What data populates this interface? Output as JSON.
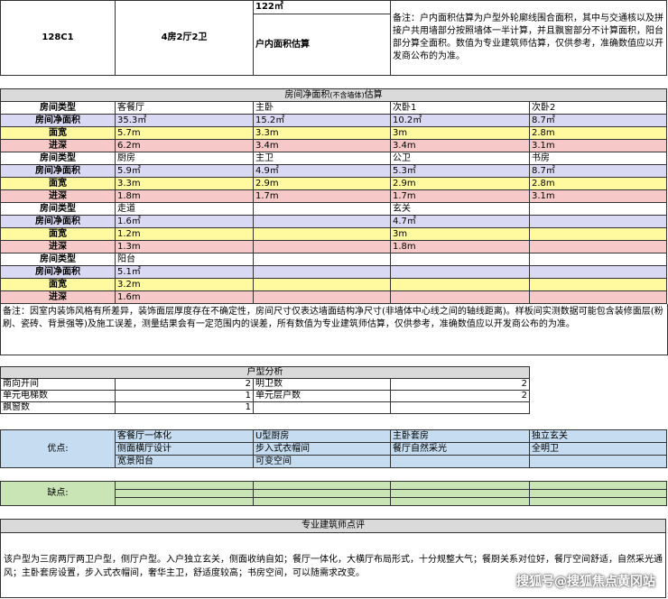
{
  "header": {
    "plan_code": "128C1",
    "layout": "4房2厅2卫",
    "area": "122㎡",
    "area_label": "户内面积估算",
    "note": "备注：户内面积估算为户型外轮廓线围合面积，其中与交通核以及拼接户共用墙部分按照墙体一半计算，并且飘窗部分不计算面积，阳台部分算全面积。数值为专业建筑师估算，仅供参考，准确数值应以开发商公布的为准。"
  },
  "rooms": {
    "title_main": "房间净面积",
    "title_small": "(不含墙体)",
    "title_tail": "估算",
    "labels": {
      "type": "房间类型",
      "area": "房间净面积",
      "width": "面宽",
      "depth": "进深"
    },
    "groups": [
      [
        {
          "name": "客餐厅",
          "area": "35.3㎡",
          "width": "5.7m",
          "depth": "6.2m"
        },
        {
          "name": "主卧",
          "area": "15.2㎡",
          "width": "3.3m",
          "depth": "3.4m"
        },
        {
          "name": "次卧1",
          "area": "10.2㎡",
          "width": "3m",
          "depth": "3.4m"
        },
        {
          "name": "次卧2",
          "area": "8.7㎡",
          "width": "2.8m",
          "depth": "3.1m"
        }
      ],
      [
        {
          "name": "厨房",
          "area": "5.9㎡",
          "width": "3.3m",
          "depth": "1.8m"
        },
        {
          "name": "主卫",
          "area": "4.9㎡",
          "width": "2.9m",
          "depth": "1.7m"
        },
        {
          "name": "公卫",
          "area": "5.3㎡",
          "width": "2.9m",
          "depth": "1.7m"
        },
        {
          "name": "书房",
          "area": "8.7㎡",
          "width": "2.8m",
          "depth": "3.1m"
        }
      ],
      [
        {
          "name": "走道",
          "area": "1.6㎡",
          "width": "1.2m",
          "depth": "1.3m"
        },
        {
          "name": "",
          "area": "",
          "width": "",
          "depth": ""
        },
        {
          "name": "玄关",
          "area": "4.7㎡",
          "width": "3m",
          "depth": "1.8m"
        },
        {
          "name": "",
          "area": "",
          "width": "",
          "depth": ""
        }
      ],
      [
        {
          "name": "阳台",
          "area": "5.1㎡",
          "width": "3.2m",
          "depth": "1.6m"
        },
        {
          "name": "",
          "area": "",
          "width": "",
          "depth": ""
        },
        {
          "name": "",
          "area": "",
          "width": "",
          "depth": ""
        },
        {
          "name": "",
          "area": "",
          "width": "",
          "depth": ""
        }
      ]
    ],
    "note": "备注：因室内装饰风格有所差异，装饰面层厚度存在不确定性，房间尺寸仅表达墙面结构净尺寸(非墙体中心线之间的轴线距离)。样板间实测数据可能包含装修面层(粉刷、瓷砖、背景强等)及施工误差，测量结果会有一定范围内的误差，所有数值为专业建筑师估算，仅供参考，准确数值应以开发商公布的为准。"
  },
  "analysis": {
    "title": "户型分析",
    "rows": [
      {
        "l_label": "南向开间",
        "l_val": "2",
        "r_label": "明卫数",
        "r_val": "2"
      },
      {
        "l_label": "单元电梯数",
        "l_val": "1",
        "r_label": "单元层户数",
        "r_val": "2"
      },
      {
        "l_label": "飘窗数",
        "l_val": "1",
        "r_label": "",
        "r_val": ""
      }
    ]
  },
  "pros": {
    "label": "优点:",
    "rows": [
      [
        "客餐厅一体化",
        "U型厨房",
        "主卧套房",
        "独立玄关"
      ],
      [
        "侧面横厅设计",
        "步入式衣帽间",
        "餐厅自然采光",
        "全明卫"
      ],
      [
        "宽景阳台",
        "可变空间",
        "",
        ""
      ]
    ]
  },
  "cons": {
    "label": "缺点:"
  },
  "review": {
    "title": "专业建筑师点评",
    "text": "该户型为三房两厅两卫户型，侧厅户型。入户独立玄关，侧面收纳自如；餐厅一体化，大横厅布局形式，十分规整大气；餐厨关系对位好，餐厅空间舒适，自然采光通风；主卧套房设置，步入式衣帽间，奢华主卫，舒适度较高；书房空间，可以随需求改变。"
  },
  "watermark": "搜狐号@搜狐焦点黄冈站"
}
